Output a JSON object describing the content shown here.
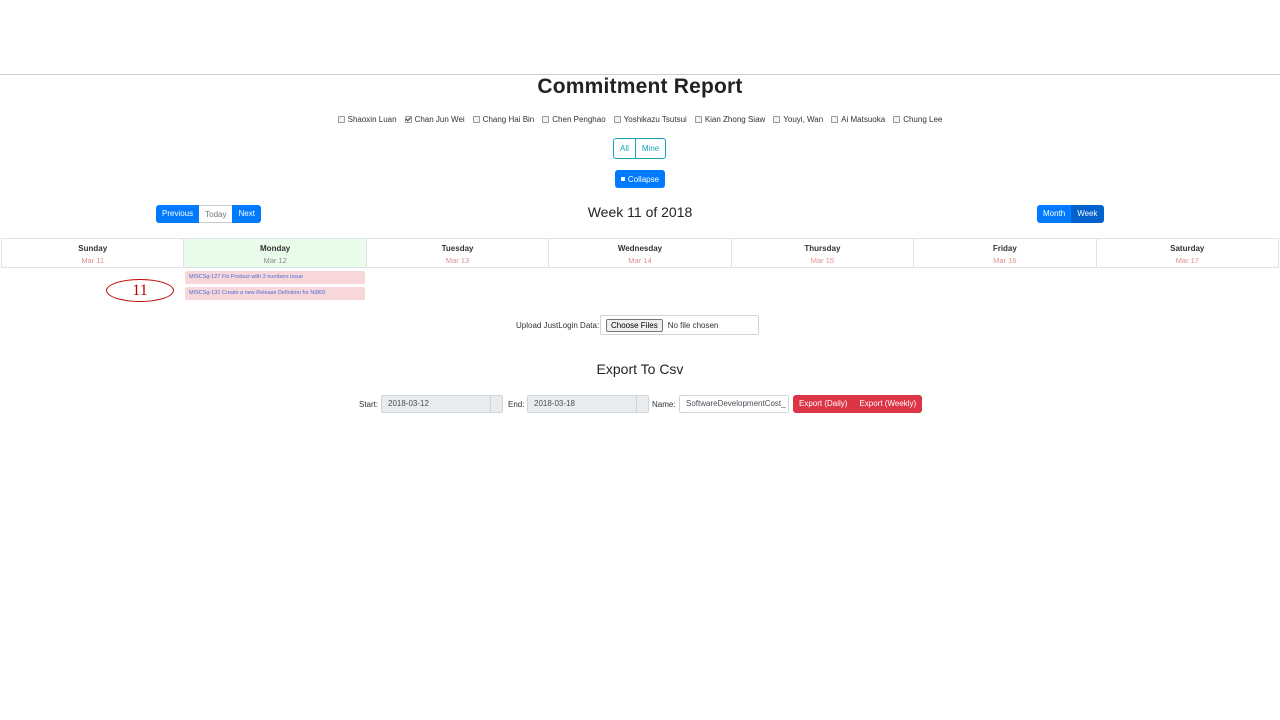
{
  "page": {
    "title": "Commitment Report"
  },
  "users": [
    {
      "name": "Shaoxin Luan",
      "checked": false
    },
    {
      "name": "Chan Jun Wei",
      "checked": true
    },
    {
      "name": "Chang Hai Bin",
      "checked": false
    },
    {
      "name": "Chen Penghao",
      "checked": false
    },
    {
      "name": "Yoshikazu Tsutsui",
      "checked": false
    },
    {
      "name": "Kian Zhong Siaw",
      "checked": false
    },
    {
      "name": "Youyi, Wan",
      "checked": false
    },
    {
      "name": "Ai Matsuoka",
      "checked": false
    },
    {
      "name": "Chung Lee",
      "checked": false
    }
  ],
  "filter": {
    "all": "All",
    "mine": "Mine"
  },
  "collapse": {
    "label": "Collapse"
  },
  "nav": {
    "previous": "Previous",
    "today": "Today",
    "next": "Next"
  },
  "calendar": {
    "title": "Week 11 of 2018",
    "view_month": "Month",
    "view_week": "Week",
    "active_view": "Week",
    "days": [
      {
        "name": "Sunday",
        "date": "Mar 11"
      },
      {
        "name": "Monday",
        "date": "Mar 12"
      },
      {
        "name": "Tuesday",
        "date": "Mar 13"
      },
      {
        "name": "Wednesday",
        "date": "Mar 14"
      },
      {
        "name": "Thursday",
        "date": "Mar 15"
      },
      {
        "name": "Friday",
        "date": "Mar 16"
      },
      {
        "name": "Saturday",
        "date": "Mar 17"
      }
    ],
    "today_index": 1,
    "events": [
      "MISCSg-127 Fix Product with 3 numbers issue",
      "MISCSg-131 Create a new Release Definition for NI869"
    ]
  },
  "annotation": {
    "label": "11",
    "color": "#c00000"
  },
  "upload": {
    "label": "Upload JustLogin Data:",
    "button": "Choose Files",
    "status": "No file chosen"
  },
  "export": {
    "title": "Export To Csv",
    "start_label": "Start:",
    "start_value": "2018-03-12",
    "end_label": "End:",
    "end_value": "2018-03-18",
    "name_label": "Name:",
    "name_value": "SoftwareDevelopmentCost_",
    "daily_button": "Export (Daily)",
    "weekly_button": "Export (Weekly)"
  },
  "colors": {
    "primary": "#007bff",
    "info": "#17a2b8",
    "danger": "#dc3545",
    "today_bg": "#e9fbe9",
    "event_bg": "#f8d7da"
  }
}
